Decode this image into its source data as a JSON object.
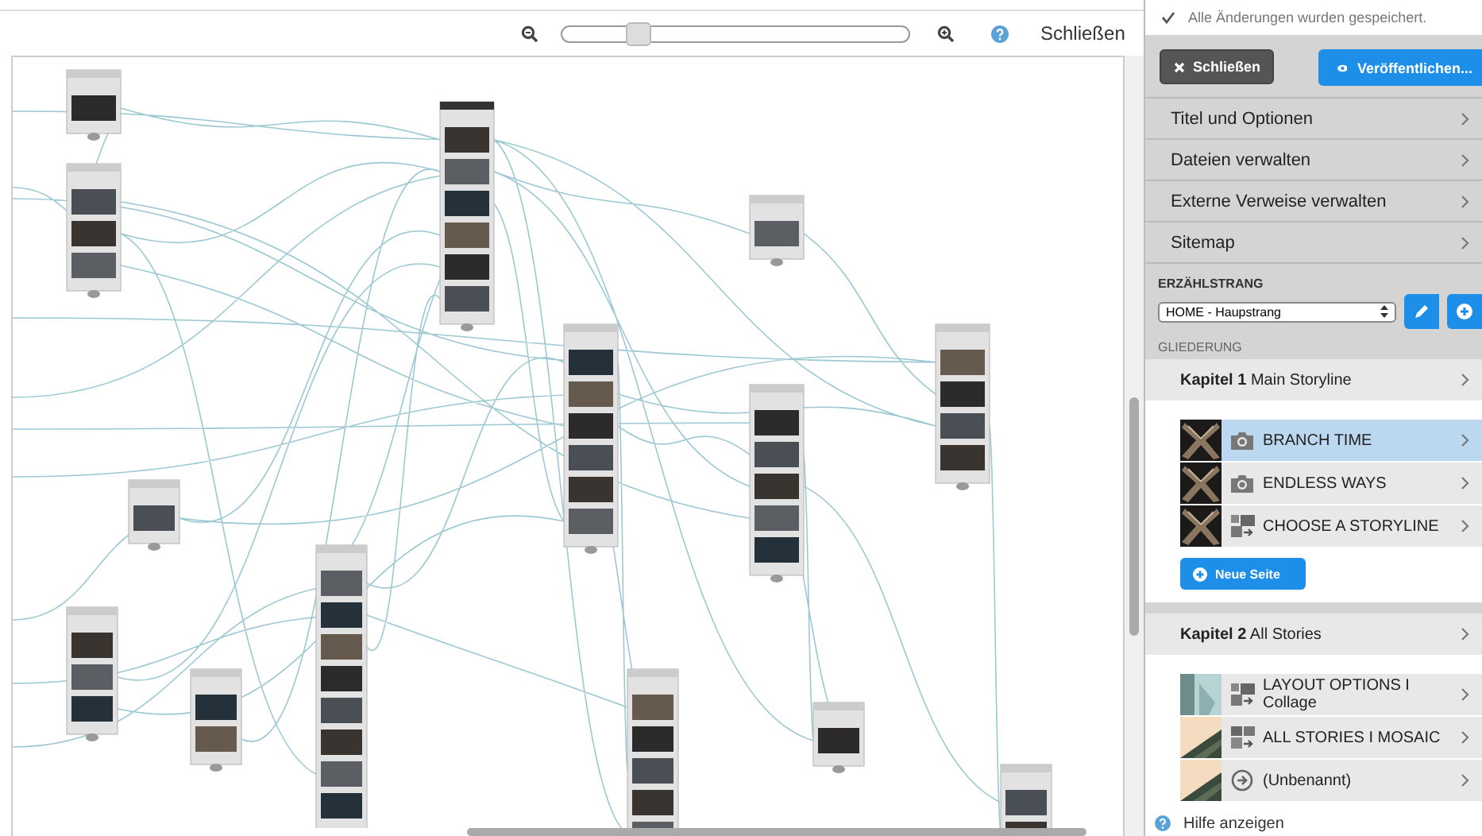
{
  "toolbar": {
    "zoom": {
      "level": 0.22
    },
    "close": "Schließen"
  },
  "panel": {
    "status": "Alle Änderungen wurden gespeichert.",
    "close_button": "Schließen",
    "publish_button": "Veröffentlichen...",
    "menu": [
      "Titel und Optionen",
      "Dateien verwalten",
      "Externe Verweise verwalten",
      "Sitemap"
    ],
    "storyline": {
      "label": "ERZÄHLSTRANG",
      "select": "HOME - Haupstrang"
    },
    "outline_label": "GLIEDERUNG",
    "chapters": [
      {
        "number": "Kapitel 1",
        "title": "Main Storyline",
        "new_page": "Neue Seite",
        "pages": [
          {
            "title": "BRANCH TIME",
            "color": "#1c1a18",
            "selected": true
          },
          {
            "title": "ENDLESS WAYS",
            "color": "#1c1a18",
            "selected": false
          },
          {
            "title": "CHOOSE A STORYLINE",
            "kind": "layout",
            "color": "#1c1a18",
            "selected": false
          }
        ]
      },
      {
        "number": "Kapitel 2",
        "title": "All Stories",
        "pages": [
          {
            "title": "LAYOUT OPTIONS I Collage",
            "kind": "layout",
            "color": "#b8d3d3",
            "selected": false
          },
          {
            "title": "ALL STORIES I MOSAIC",
            "kind": "mosaic",
            "color": "#f4dcc0",
            "selected": false
          },
          {
            "title": "(Unbenannt)",
            "kind": "link",
            "color": "#f4dcc0",
            "selected": false
          }
        ]
      }
    ]
  },
  "help": "Hilfe anzeigen"
}
